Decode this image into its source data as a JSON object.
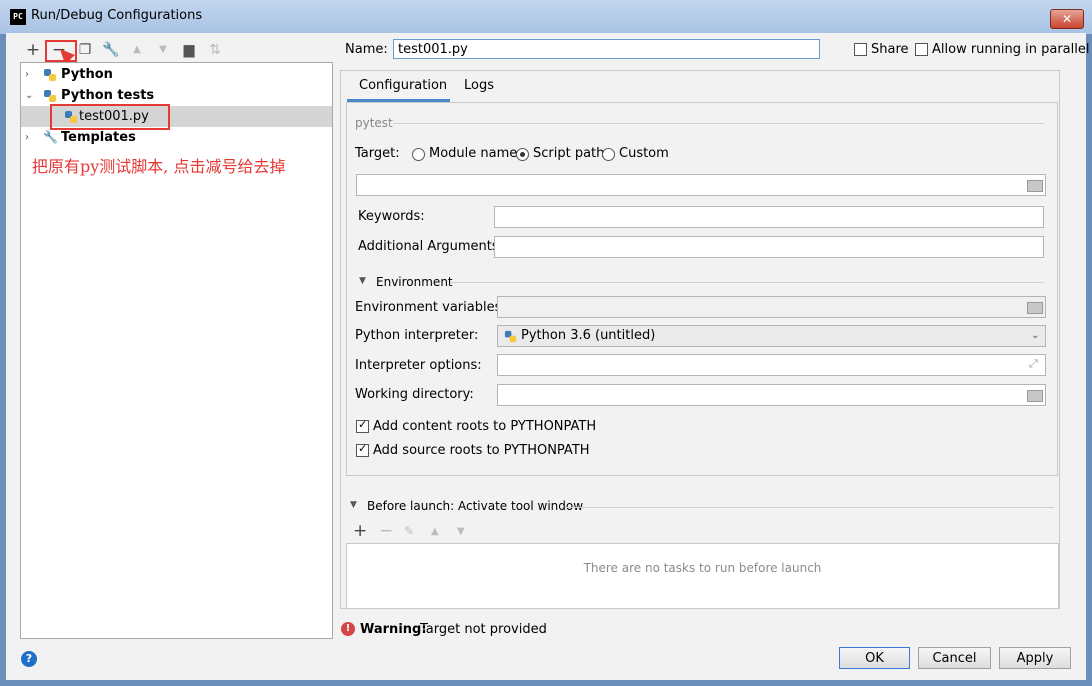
{
  "window": {
    "title": "Run/Debug Configurations",
    "logo": "PC"
  },
  "annotation_text": "把原有py测试脚本, 点击减号给去掉",
  "tree": {
    "items": [
      {
        "label": "Python"
      },
      {
        "label": "Python tests"
      },
      {
        "label": "test001.py"
      },
      {
        "label": "Templates"
      }
    ]
  },
  "header": {
    "name_label": "Name:",
    "name_value": "test001.py",
    "share_label": "Share",
    "parallel_label": "Allow running in parallel"
  },
  "tabs": [
    {
      "label": "Configuration"
    },
    {
      "label": "Logs"
    }
  ],
  "config": {
    "section": "pytest",
    "target_label": "Target:",
    "target_options": [
      {
        "label": "Module name"
      },
      {
        "label": "Script path"
      },
      {
        "label": "Custom"
      }
    ],
    "keywords_label": "Keywords:",
    "additional_label": "Additional Arguments:",
    "environment_label": "Environment",
    "env_vars_label": "Environment variables:",
    "interpreter_label": "Python interpreter:",
    "interpreter_value": "Python 3.6 (untitled)",
    "interp_options_label": "Interpreter options:",
    "working_dir_label": "Working directory:",
    "content_roots_label": "Add content roots to PYTHONPATH",
    "source_roots_label": "Add source roots to PYTHONPATH"
  },
  "before_launch": {
    "title": "Before launch: Activate tool window",
    "empty_text": "There are no tasks to run before launch"
  },
  "warning": {
    "bold": "Warning:",
    "text": "Target not provided"
  },
  "buttons": {
    "ok": "OK",
    "cancel": "Cancel",
    "apply": "Apply"
  },
  "help_glyph": "?",
  "icons": {
    "toolbar": [
      "add-icon",
      "remove-icon",
      "copy-icon",
      "wrench-icon",
      "move-up-icon",
      "move-down-icon",
      "folder-icon",
      "sort-icon"
    ],
    "tasks": [
      "add-icon",
      "remove-icon",
      "edit-icon",
      "move-up-icon",
      "move-down-icon"
    ]
  },
  "colors": {
    "accent": "#4a88c7",
    "annotation": "#e53935"
  }
}
